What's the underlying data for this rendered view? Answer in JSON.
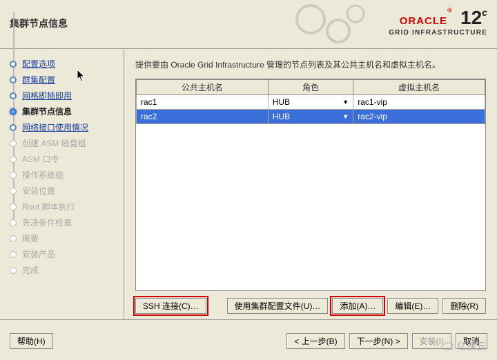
{
  "header": {
    "title": "集群节点信息",
    "logo_brand": "ORACLE",
    "logo_suffix": "®",
    "logo_sub": "GRID INFRASTRUCTURE",
    "logo_version": "12",
    "logo_version_sup": "c"
  },
  "sidebar": {
    "steps": [
      {
        "label": "配置选项",
        "state": "visited"
      },
      {
        "label": "群集配置",
        "state": "visited"
      },
      {
        "label": "网格即插即用",
        "state": "visited"
      },
      {
        "label": "集群节点信息",
        "state": "current"
      },
      {
        "label": "网络接口使用情况",
        "state": "visited"
      },
      {
        "label": "创建 ASM 磁盘组",
        "state": "future"
      },
      {
        "label": "ASM 口令",
        "state": "future"
      },
      {
        "label": "操作系统组",
        "state": "future"
      },
      {
        "label": "安装位置",
        "state": "future"
      },
      {
        "label": "Root 脚本执行",
        "state": "future"
      },
      {
        "label": "先决条件检查",
        "state": "future"
      },
      {
        "label": "概要",
        "state": "future"
      },
      {
        "label": "安装产品",
        "state": "future"
      },
      {
        "label": "完成",
        "state": "future"
      }
    ]
  },
  "main": {
    "instruction": "提供要由 Oracle Grid Infrastructure 管理的节点列表及其公共主机名和虚拟主机名。",
    "columns": {
      "host": "公共主机名",
      "role": "角色",
      "vip": "虚拟主机名"
    },
    "rows": [
      {
        "host": "rac1",
        "role": "HUB",
        "vip": "rac1-vip",
        "selected": false
      },
      {
        "host": "rac2",
        "role": "HUB",
        "vip": "rac2-vip",
        "selected": true
      }
    ],
    "buttons": {
      "ssh": "SSH 连接(C)…",
      "use_file": "使用集群配置文件(U)…",
      "add": "添加(A)…",
      "edit": "编辑(E)…",
      "delete": "删除(R)"
    }
  },
  "footer": {
    "help": "帮助(H)",
    "back": "< 上一步(B)",
    "next": "下一步(N) >",
    "install": "安装(I)",
    "cancel": "取消"
  },
  "watermark": "亿速云"
}
